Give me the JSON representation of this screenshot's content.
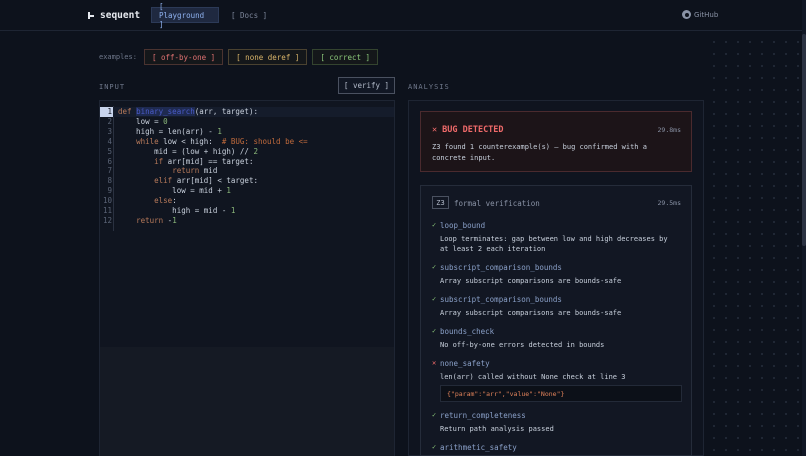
{
  "header": {
    "brand": "sequent",
    "nav": [
      {
        "label": "[ Playground ]",
        "active": true
      },
      {
        "label": "[ Docs ]",
        "active": false
      }
    ],
    "github_label": "GitHub"
  },
  "examples": {
    "label": "examples:",
    "items": [
      {
        "label": "[ off-by-one ]",
        "color": "#e07272"
      },
      {
        "label": "[ none deref ]",
        "color": "#d9b56a"
      },
      {
        "label": "[ correct ]",
        "color": "#8cc97a"
      }
    ]
  },
  "input": {
    "label": "INPUT",
    "verify_label": "[ verify ]",
    "current_line": 1,
    "lines": [
      {
        "n": "1",
        "tokens": [
          {
            "t": "def ",
            "c": "kw"
          },
          {
            "t": "binary_search",
            "c": "fn"
          },
          {
            "t": "(arr, target):",
            "c": ""
          }
        ]
      },
      {
        "n": "2",
        "tokens": [
          {
            "t": "    low = ",
            "c": ""
          },
          {
            "t": "0",
            "c": "num"
          }
        ]
      },
      {
        "n": "3",
        "tokens": [
          {
            "t": "    high = len(arr) - ",
            "c": ""
          },
          {
            "t": "1",
            "c": "num"
          }
        ]
      },
      {
        "n": "4",
        "tokens": [
          {
            "t": "    ",
            "c": ""
          },
          {
            "t": "while",
            "c": "kw"
          },
          {
            "t": " low < high:  ",
            "c": ""
          },
          {
            "t": "# BUG: should be <=",
            "c": "cm"
          }
        ]
      },
      {
        "n": "5",
        "tokens": [
          {
            "t": "        mid = (low + high) // ",
            "c": ""
          },
          {
            "t": "2",
            "c": "num"
          }
        ]
      },
      {
        "n": "6",
        "tokens": [
          {
            "t": "        ",
            "c": ""
          },
          {
            "t": "if",
            "c": "kw"
          },
          {
            "t": " arr[mid] == target:",
            "c": ""
          }
        ]
      },
      {
        "n": "7",
        "tokens": [
          {
            "t": "            ",
            "c": ""
          },
          {
            "t": "return",
            "c": "kw"
          },
          {
            "t": " mid",
            "c": ""
          }
        ]
      },
      {
        "n": "8",
        "tokens": [
          {
            "t": "        ",
            "c": ""
          },
          {
            "t": "elif",
            "c": "kw"
          },
          {
            "t": " arr[mid] < target:",
            "c": ""
          }
        ]
      },
      {
        "n": "9",
        "tokens": [
          {
            "t": "            low = mid + ",
            "c": ""
          },
          {
            "t": "1",
            "c": "num"
          }
        ]
      },
      {
        "n": "10",
        "tokens": [
          {
            "t": "        ",
            "c": ""
          },
          {
            "t": "else",
            "c": "kw"
          },
          {
            "t": ":",
            "c": ""
          }
        ]
      },
      {
        "n": "11",
        "tokens": [
          {
            "t": "            high = mid - ",
            "c": ""
          },
          {
            "t": "1",
            "c": "num"
          }
        ]
      },
      {
        "n": "12",
        "tokens": [
          {
            "t": "    ",
            "c": ""
          },
          {
            "t": "return",
            "c": "kw"
          },
          {
            "t": " -",
            "c": ""
          },
          {
            "t": "1",
            "c": "num"
          }
        ]
      }
    ]
  },
  "analysis": {
    "label": "ANALYSIS",
    "bug": {
      "title": "BUG DETECTED",
      "icon": "x-icon",
      "time": "29.8ms",
      "description": "Z3 found 1 counterexample(s) — bug confirmed with a concrete input."
    },
    "formal": {
      "badge": "Z3",
      "title": "formal verification",
      "time": "29.5ms",
      "checks": [
        {
          "name": "loop_bound",
          "status": "ok",
          "desc": "Loop terminates: gap between low and high decreases by at least 2 each iteration"
        },
        {
          "name": "subscript_comparison_bounds",
          "status": "ok",
          "desc": "Array subscript comparisons are bounds-safe"
        },
        {
          "name": "subscript_comparison_bounds",
          "status": "ok",
          "desc": "Array subscript comparisons are bounds-safe"
        },
        {
          "name": "bounds_check",
          "status": "ok",
          "desc": "No off-by-one errors detected in bounds"
        },
        {
          "name": "none_safety",
          "status": "fail",
          "desc": "len(arr) called without None check at line 3",
          "evidence": "{\"param\":\"arr\",\"value\":\"None\"}"
        },
        {
          "name": "return_completeness",
          "status": "ok",
          "desc": "Return path analysis passed"
        },
        {
          "name": "arithmetic_safety",
          "status": "ok",
          "desc": ""
        }
      ]
    }
  }
}
